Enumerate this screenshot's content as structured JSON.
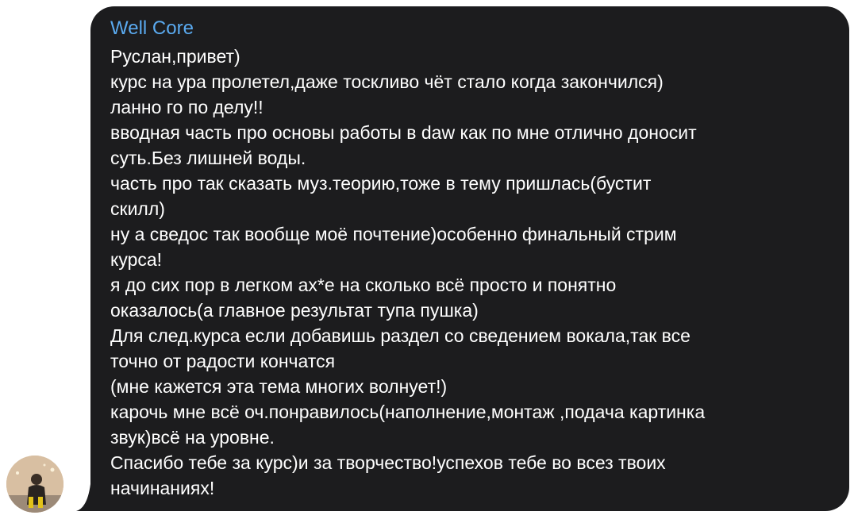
{
  "sender": {
    "name": "Well Core",
    "name_color": "#5aaaf0"
  },
  "avatar": {
    "icon": "user-photo-avatar"
  },
  "bubble": {
    "background": "#1c1c1e",
    "text_color": "#ffffff"
  },
  "message": {
    "lines": [
      "Руслан,привет)",
      "курс на ура пролетел,даже тоскливо чёт стало когда закончился)",
      "ланно го по делу!!",
      "вводная часть про основы работы в daw как по мне отлично доносит",
      "суть.Без лишней воды.",
      "часть про так сказать муз.теорию,тоже в тему пришлась(бустит",
      "скилл)",
      "ну а сведос так вообще моё почтение)особенно финальный стрим",
      "курса!",
      "я до сих пор в легком ах*е на сколько всё просто и понятно",
      "оказалось(а главное результат тупа пушка)",
      "Для след.курса если добавишь раздел со сведением вокала,так все",
      "точно от радости кончатся",
      "(мне кажется эта тема многих волнует!)",
      "карочь мне всё оч.понравилось(наполнение,монтаж ,подача картинка",
      "звук)всё на уровне.",
      "Спасибо тебе за курс)и за творчество!успехов тебе во всез твоих",
      "начинаниях!"
    ]
  }
}
